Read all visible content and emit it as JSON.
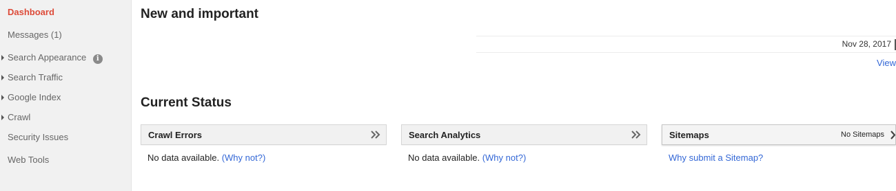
{
  "sidebar": {
    "items": [
      {
        "label": "Dashboard"
      },
      {
        "label": "Messages (1)"
      },
      {
        "label": "Search Appearance"
      },
      {
        "label": "Search Traffic"
      },
      {
        "label": "Google Index"
      },
      {
        "label": "Crawl"
      },
      {
        "label": "Security Issues"
      },
      {
        "label": "Web Tools"
      }
    ]
  },
  "new_important": {
    "title": "New and important",
    "messages": [
      {
        "date": "Nov 28, 2017"
      }
    ],
    "view_link": "View"
  },
  "current_status": {
    "title": "Current Status",
    "cards": [
      {
        "title": "Crawl Errors",
        "body_text": "No data available.",
        "body_link": "(Why not?)"
      },
      {
        "title": "Search Analytics",
        "body_text": "No data available.",
        "body_link": "(Why not?)"
      },
      {
        "title": "Sitemaps",
        "status": "No Sitemaps",
        "body_link": "Why submit a Sitemap?"
      }
    ]
  },
  "colors": {
    "active_nav": "#dd4b39",
    "link": "#3367d6",
    "sidebar_bg": "#f1f1f1"
  },
  "icons": {
    "info": "info-icon",
    "more": "double-chevron-right-icon",
    "sitemap_more": "chevron-right-icon"
  }
}
